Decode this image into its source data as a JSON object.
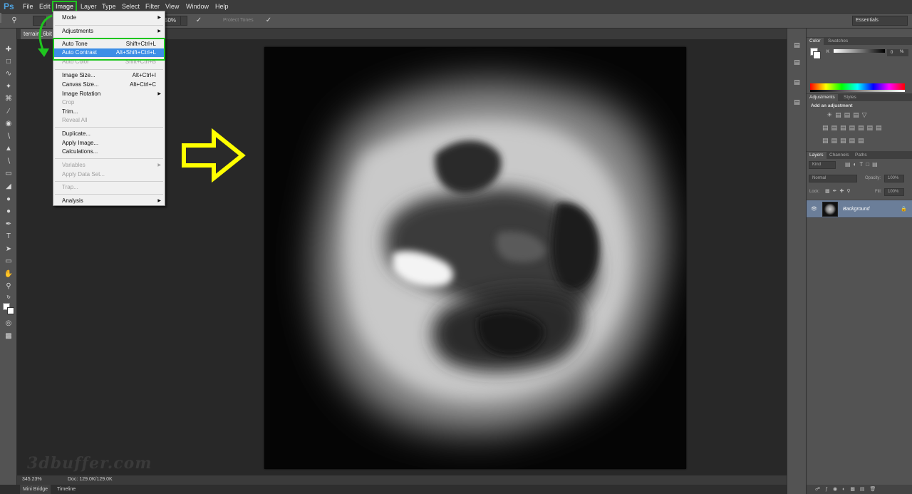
{
  "app": {
    "logo": "Ps"
  },
  "menubar": {
    "items": [
      "File",
      "Edit",
      "Image",
      "Layer",
      "Type",
      "Select",
      "Filter",
      "View",
      "Window",
      "Help"
    ]
  },
  "options": {
    "zoom_value": "50%",
    "protect_tones": "Protect Tones",
    "workspace": "Essentials"
  },
  "document": {
    "tab_title": "terrain_6bit"
  },
  "image_menu": {
    "mode": "Mode",
    "adjustments": "Adjustments",
    "auto_tone": {
      "label": "Auto Tone",
      "shortcut": "Shift+Ctrl+L"
    },
    "auto_contrast": {
      "label": "Auto Contrast",
      "shortcut": "Alt+Shift+Ctrl+L"
    },
    "auto_color": {
      "label": "Auto Color",
      "shortcut": "Shift+Ctrl+B"
    },
    "image_size": {
      "label": "Image Size...",
      "shortcut": "Alt+Ctrl+I"
    },
    "canvas_size": {
      "label": "Canvas Size...",
      "shortcut": "Alt+Ctrl+C"
    },
    "image_rotation": "Image Rotation",
    "crop": "Crop",
    "trim": "Trim...",
    "reveal_all": "Reveal All",
    "duplicate": "Duplicate...",
    "apply_image": "Apply Image...",
    "calculations": "Calculations...",
    "variables": "Variables",
    "apply_data_set": "Apply Data Set...",
    "trap": "Trap...",
    "analysis": "Analysis"
  },
  "status": {
    "zoom": "345.23%",
    "doc": "Doc: 129.0K/129.0K"
  },
  "bottom_tabs": [
    "Mini Bridge",
    "Timeline"
  ],
  "watermark": "3dbuffer.com",
  "panels": {
    "color_tabs": [
      "Color",
      "Swatches"
    ],
    "k_label": "K",
    "k_value": "0",
    "k_unit": "%",
    "adjustment_tabs": [
      "Adjustments",
      "Styles"
    ],
    "add_adjustment": "Add an adjustment",
    "layer_tabs": [
      "Layers",
      "Channels",
      "Paths"
    ],
    "kind": "Kind",
    "blend_mode": "Normal",
    "opacity_label": "Opacity:",
    "opacity_value": "100%",
    "lock_label": "Lock:",
    "fill_label": "Fill:",
    "fill_value": "100%",
    "layer_name": "Background"
  },
  "colors": {
    "highlight_green": "#1fc51f",
    "menu_selection": "#3d8ee6",
    "arrow_yellow": "#ffff00",
    "layer_selected": "#6b7e99"
  }
}
